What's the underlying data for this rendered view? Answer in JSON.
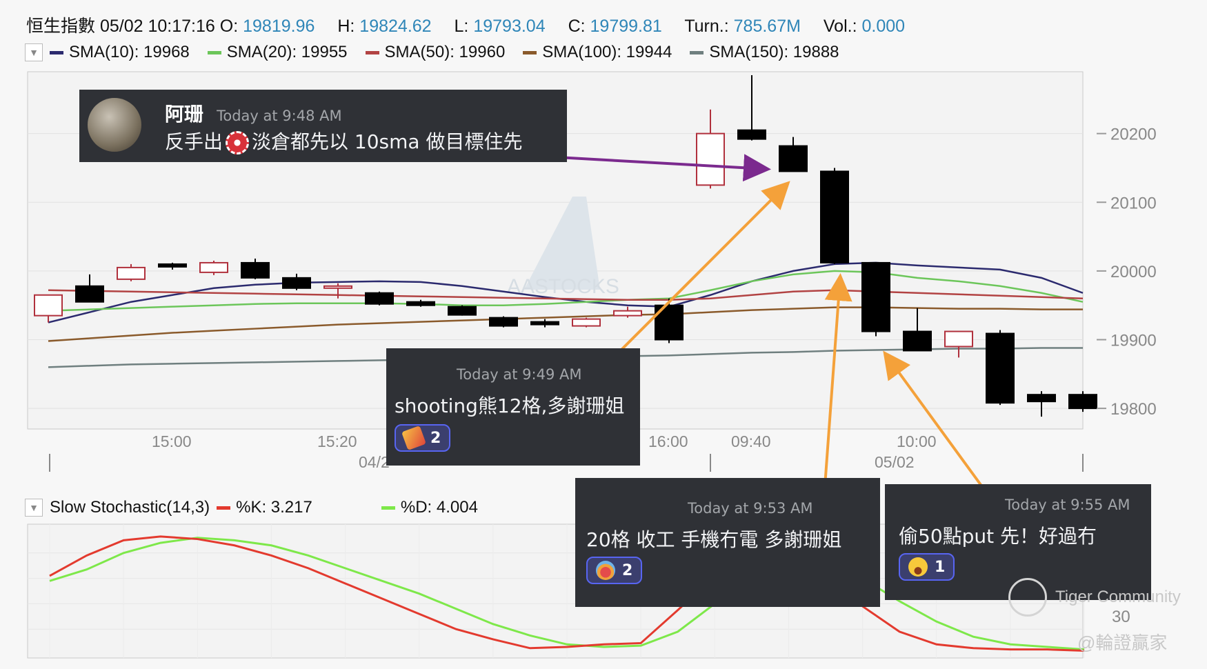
{
  "header": {
    "symbol": "恒生指數",
    "datetime": "05/02 10:17:16",
    "o_label": "O:",
    "o_value": "19819.96",
    "h_label": "H:",
    "h_value": "19824.62",
    "l_label": "L:",
    "l_value": "19793.04",
    "c_label": "C:",
    "c_value": "19799.81",
    "turn_label": "Turn.:",
    "turn_value": "785.67M",
    "vol_label": "Vol.:",
    "vol_value": "0.000"
  },
  "sma_legend": [
    {
      "label": "SMA(10): 19968",
      "color": "#2b2a6e"
    },
    {
      "label": "SMA(20): 19955",
      "color": "#6cc65a"
    },
    {
      "label": "SMA(50): 19960",
      "color": "#b24343"
    },
    {
      "label": "SMA(100): 19944",
      "color": "#8a5a2b"
    },
    {
      "label": "SMA(150): 19888",
      "color": "#6f7f7f"
    }
  ],
  "stoch_legend": {
    "title": "Slow Stochastic(14,3)",
    "k_label": "%K: 3.217",
    "k_color": "#e33a2e",
    "d_label": "%D: 4.004",
    "d_color": "#7ee84a"
  },
  "chart_data": [
    {
      "type": "candlestick",
      "ylim": [
        19770,
        20290
      ],
      "y_ticks": [
        19800,
        19900,
        20000,
        20100,
        20200
      ],
      "x_tick_labels": [
        "15:00",
        "15:20",
        "16:00",
        "09:40",
        "10:00"
      ],
      "date_labels": [
        "04/2",
        "05/02"
      ],
      "candles": [
        {
          "o": 19935,
          "h": 19950,
          "l": 19925,
          "c": 19965
        },
        {
          "o": 19978,
          "h": 19995,
          "l": 19960,
          "c": 19955
        },
        {
          "o": 19988,
          "h": 20010,
          "l": 19985,
          "c": 20005
        },
        {
          "o": 20010,
          "h": 20012,
          "l": 20002,
          "c": 20006
        },
        {
          "o": 19998,
          "h": 20015,
          "l": 19994,
          "c": 20012
        },
        {
          "o": 20012,
          "h": 20018,
          "l": 19988,
          "c": 19990
        },
        {
          "o": 19990,
          "h": 19996,
          "l": 19972,
          "c": 19975
        },
        {
          "o": 19978,
          "h": 19982,
          "l": 19960,
          "c": 19978
        },
        {
          "o": 19968,
          "h": 19970,
          "l": 19950,
          "c": 19952
        },
        {
          "o": 19955,
          "h": 19958,
          "l": 19948,
          "c": 19950
        },
        {
          "o": 19948,
          "h": 19950,
          "l": 19935,
          "c": 19936
        },
        {
          "o": 19932,
          "h": 19934,
          "l": 19918,
          "c": 19920
        },
        {
          "o": 19926,
          "h": 19930,
          "l": 19918,
          "c": 19922
        },
        {
          "o": 19920,
          "h": 19932,
          "l": 19918,
          "c": 19930
        },
        {
          "o": 19935,
          "h": 19948,
          "l": 19932,
          "c": 19942
        },
        {
          "o": 19950,
          "h": 19960,
          "l": 19895,
          "c": 19900
        },
        {
          "o": 20125,
          "h": 20235,
          "l": 20120,
          "c": 20200
        },
        {
          "o": 20205,
          "h": 20285,
          "l": 20190,
          "c": 20192
        },
        {
          "o": 20182,
          "h": 20195,
          "l": 20145,
          "c": 20145
        },
        {
          "o": 20145,
          "h": 20150,
          "l": 20010,
          "c": 20012
        },
        {
          "o": 20012,
          "h": 20012,
          "l": 19905,
          "c": 19912
        },
        {
          "o": 19912,
          "h": 19946,
          "l": 19884,
          "c": 19884
        },
        {
          "o": 19890,
          "h": 19912,
          "l": 19874,
          "c": 19912
        },
        {
          "o": 19909,
          "h": 19914,
          "l": 19805,
          "c": 19808
        },
        {
          "o": 19820,
          "h": 19825,
          "l": 19788,
          "c": 19810
        },
        {
          "o": 19820,
          "h": 19825,
          "l": 19795,
          "c": 19800
        }
      ],
      "series": [
        {
          "name": "SMA(10)",
          "color": "#2b2a6e",
          "values": [
            19925,
            19940,
            19955,
            19965,
            19975,
            19980,
            19983,
            19984,
            19985,
            19984,
            19978,
            19970,
            19962,
            19955,
            19950,
            19948,
            19965,
            19985,
            20000,
            20010,
            20012,
            20008,
            20005,
            20002,
            19990,
            19968
          ]
        },
        {
          "name": "SMA(20)",
          "color": "#6cc65a",
          "values": [
            19942,
            19944,
            19946,
            19948,
            19950,
            19952,
            19953,
            19953,
            19953,
            19952,
            19950,
            19950,
            19952,
            19955,
            19958,
            19960,
            19972,
            19985,
            19995,
            20000,
            19998,
            19990,
            19985,
            19978,
            19968,
            19955
          ]
        },
        {
          "name": "SMA(50)",
          "color": "#b24343",
          "values": [
            19972,
            19971,
            19970,
            19969,
            19968,
            19967,
            19966,
            19965,
            19964,
            19963,
            19962,
            19961,
            19960,
            19959,
            19958,
            19958,
            19960,
            19965,
            19970,
            19972,
            19970,
            19968,
            19966,
            19964,
            19962,
            19960
          ]
        },
        {
          "name": "SMA(100)",
          "color": "#8a5a2b",
          "values": [
            19898,
            19902,
            19906,
            19910,
            19913,
            19916,
            19919,
            19922,
            19924,
            19926,
            19928,
            19930,
            19932,
            19934,
            19936,
            19937,
            19940,
            19943,
            19945,
            19947,
            19947,
            19946,
            19945,
            19945,
            19944,
            19944
          ]
        },
        {
          "name": "SMA(150)",
          "color": "#6f7f7f",
          "values": [
            19860,
            19862,
            19864,
            19865,
            19866,
            19867,
            19868,
            19869,
            19870,
            19871,
            19872,
            19873,
            19874,
            19875,
            19876,
            19877,
            19879,
            19881,
            19882,
            19884,
            19885,
            19886,
            19887,
            19887,
            19888,
            19888
          ]
        }
      ]
    },
    {
      "type": "line",
      "ylim": [
        0,
        100
      ],
      "y_ticks": [
        30
      ],
      "series": [
        {
          "name": "%K",
          "color": "#e33a2e",
          "values": [
            62,
            78,
            90,
            93,
            91,
            86,
            78,
            68,
            56,
            44,
            32,
            20,
            12,
            5,
            6,
            8,
            9,
            35,
            62,
            78,
            78,
            60,
            38,
            18,
            8,
            5,
            4,
            4,
            3
          ]
        },
        {
          "name": "%D",
          "color": "#7ee84a",
          "values": [
            58,
            67,
            80,
            88,
            92,
            90,
            86,
            78,
            68,
            58,
            48,
            36,
            24,
            15,
            8,
            6,
            7,
            18,
            40,
            58,
            75,
            72,
            60,
            42,
            26,
            14,
            8,
            6,
            4
          ]
        }
      ]
    }
  ],
  "annotations": [
    {
      "name": "阿珊",
      "time": "Today at 9:48 AM",
      "msg_a": "反手出",
      "msg_b": "淡倉都先以 10sma 做目標住先"
    },
    {
      "time": "Today at 9:49 AM",
      "msg": "shooting熊12格,多謝珊姐",
      "count": "2"
    },
    {
      "time": "Today at 9:53 AM",
      "msg": "20格 收工 手機冇電 多謝珊姐",
      "count": "2"
    },
    {
      "time": "Today at 9:55 AM",
      "msg": "偷50點put 先！好過冇",
      "count": "1"
    }
  ],
  "watermarks": {
    "aastocks": "AASTOCKS",
    "tiger": "Tiger Community",
    "author": "@輪證贏家"
  },
  "colors": {
    "value_blue": "#2f86b8",
    "up_candle": "#b0303c",
    "down_candle": "#000000",
    "arrow_purple": "#7b2a8e",
    "arrow_orange": "#f4a13a"
  }
}
